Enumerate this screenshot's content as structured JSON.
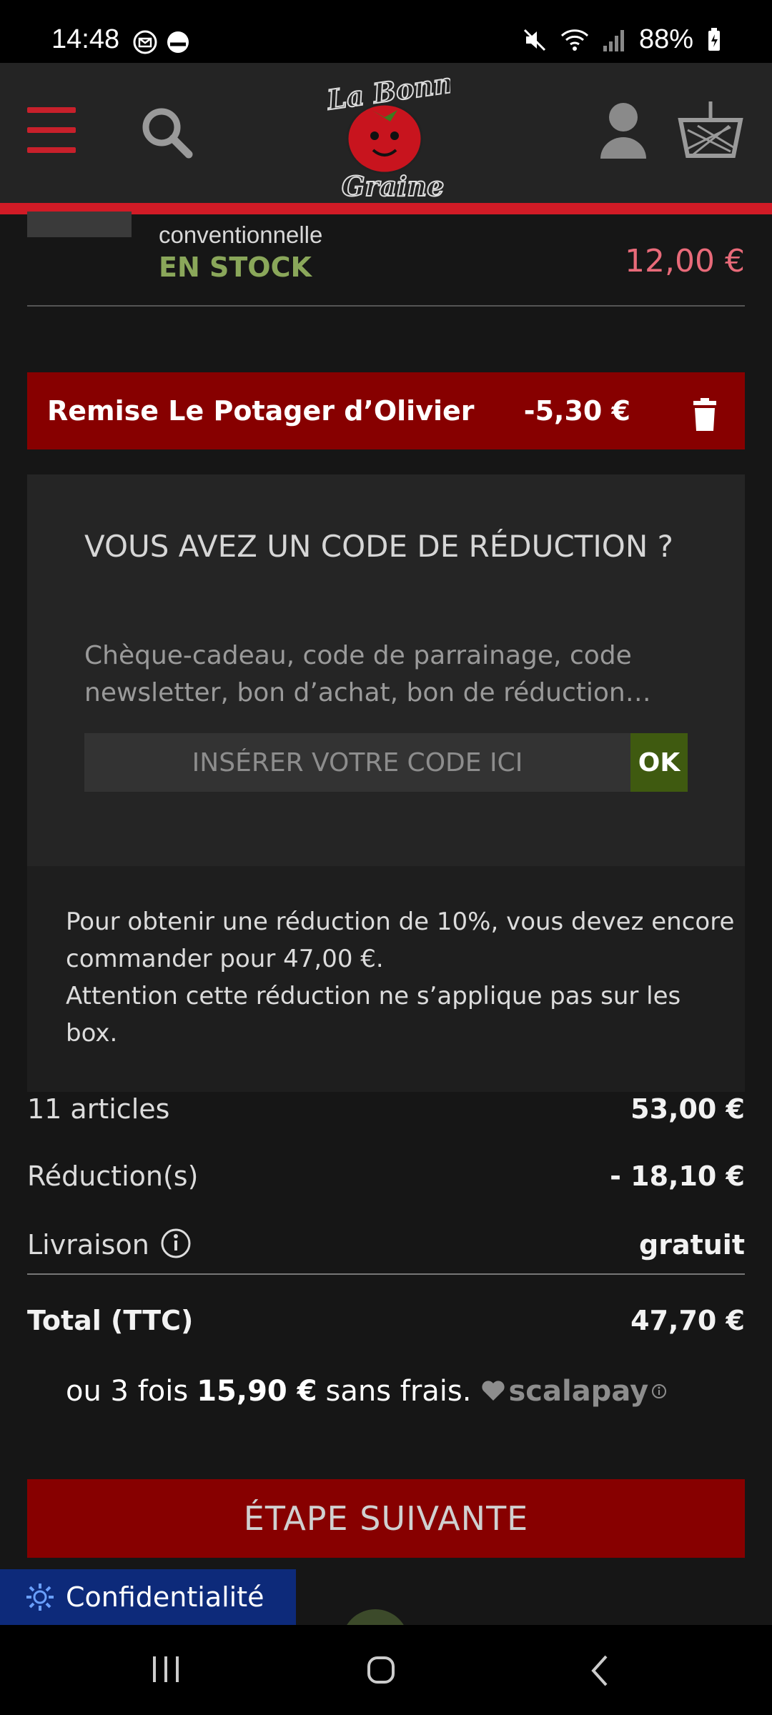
{
  "status_bar": {
    "time": "14:48",
    "battery": "88%"
  },
  "header": {
    "logo_top": "La Bonne",
    "logo_bottom": "Graine"
  },
  "product": {
    "subtitle": "conventionnelle",
    "stock": "EN STOCK",
    "price": "12,00 €"
  },
  "promo": {
    "label": "Remise Le Potager d’Olivier",
    "amount": "-5,30 €"
  },
  "code": {
    "title": "VOUS AVEZ UN CODE DE RÉDUCTION ?",
    "description": "Chèque-cadeau, code de parrainage, code newsletter, bon d’achat, bon de réduction…",
    "placeholder": "INSÉRER VOTRE CODE ICI",
    "ok_label": "OK"
  },
  "info": {
    "line1": "Pour obtenir une réduction de 10%, vous devez encore commander pour 47,00 €.",
    "line2": "Attention cette réduction ne s’applique pas sur les box."
  },
  "summary": {
    "articles_label": "11 articles",
    "articles_value": "53,00 €",
    "reductions_label": "Réduction(s)",
    "reductions_value": "- 18,10 €",
    "shipping_label": "Livraison",
    "shipping_value": "gratuit",
    "total_label": "Total (TTC)",
    "total_value": "47,70 €"
  },
  "scalapay": {
    "prefix": "ou 3 fois",
    "amount": "15,90 €",
    "suffix": "sans frais.",
    "brand": "scalapay"
  },
  "next_button": "ÉTAPE SUIVANTE",
  "privacy_button": "Confidentialité",
  "colors": {
    "accent_red": "#d11b26",
    "button_red": "#870000",
    "ok_green": "#3f5a10",
    "stock_green": "#8aa75a",
    "price_pink": "#e86a79",
    "privacy_blue": "#0d2a7a"
  }
}
